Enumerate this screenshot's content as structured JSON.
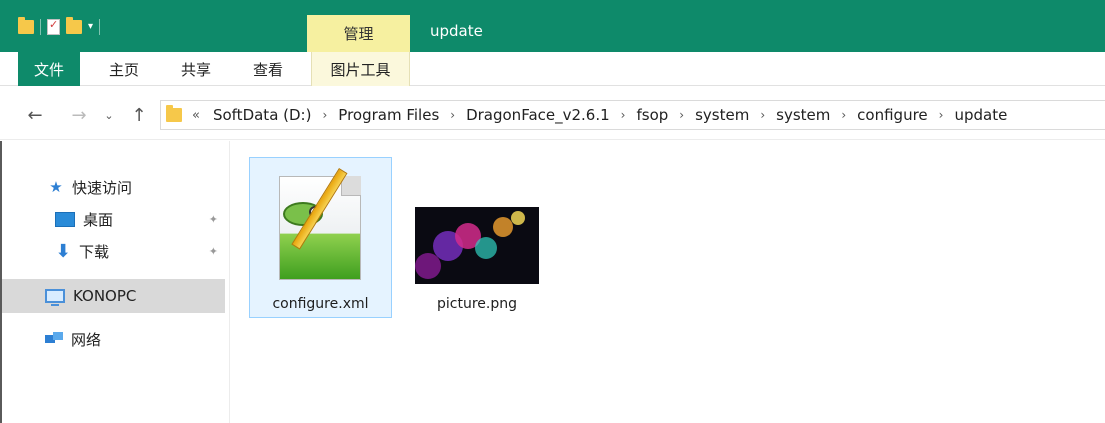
{
  "window": {
    "title": "update",
    "contextual_tab_group": "管理"
  },
  "ribbon": {
    "tabs": [
      "文件",
      "主页",
      "共享",
      "查看",
      "图片工具"
    ],
    "active_tab": "文件"
  },
  "quick_access_toolbar": {
    "icons": [
      "folder-icon",
      "properties-icon",
      "new-folder-icon",
      "customize-dropdown-icon"
    ]
  },
  "navigation": {
    "back_icon": "←",
    "forward_icon": "→",
    "recent_icon": "⌄",
    "up_icon": "↑"
  },
  "address_bar": {
    "overflow": "«",
    "separator": "›",
    "breadcrumbs": [
      "SoftData (D:)",
      "Program Files",
      "DragonFace_v2.6.1",
      "fsop",
      "system",
      "system",
      "configure",
      "update"
    ]
  },
  "nav_pane": {
    "quick_access": "快速访问",
    "pinned": [
      {
        "label": "桌面",
        "icon": "desktop-icon"
      },
      {
        "label": "下载",
        "icon": "download-icon"
      }
    ],
    "this_pc": "KONOPC",
    "network": "网络"
  },
  "files": [
    {
      "name": "configure.xml",
      "icon": "notepadpp-file-icon",
      "selected": true
    },
    {
      "name": "picture.png",
      "icon": "image-thumbnail",
      "selected": false
    }
  ],
  "colors": {
    "titlebar": "#0e8a6a",
    "contextual_tab": "#f6f0a0",
    "selection": "#e5f3ff",
    "selection_border": "#99d1ff"
  }
}
